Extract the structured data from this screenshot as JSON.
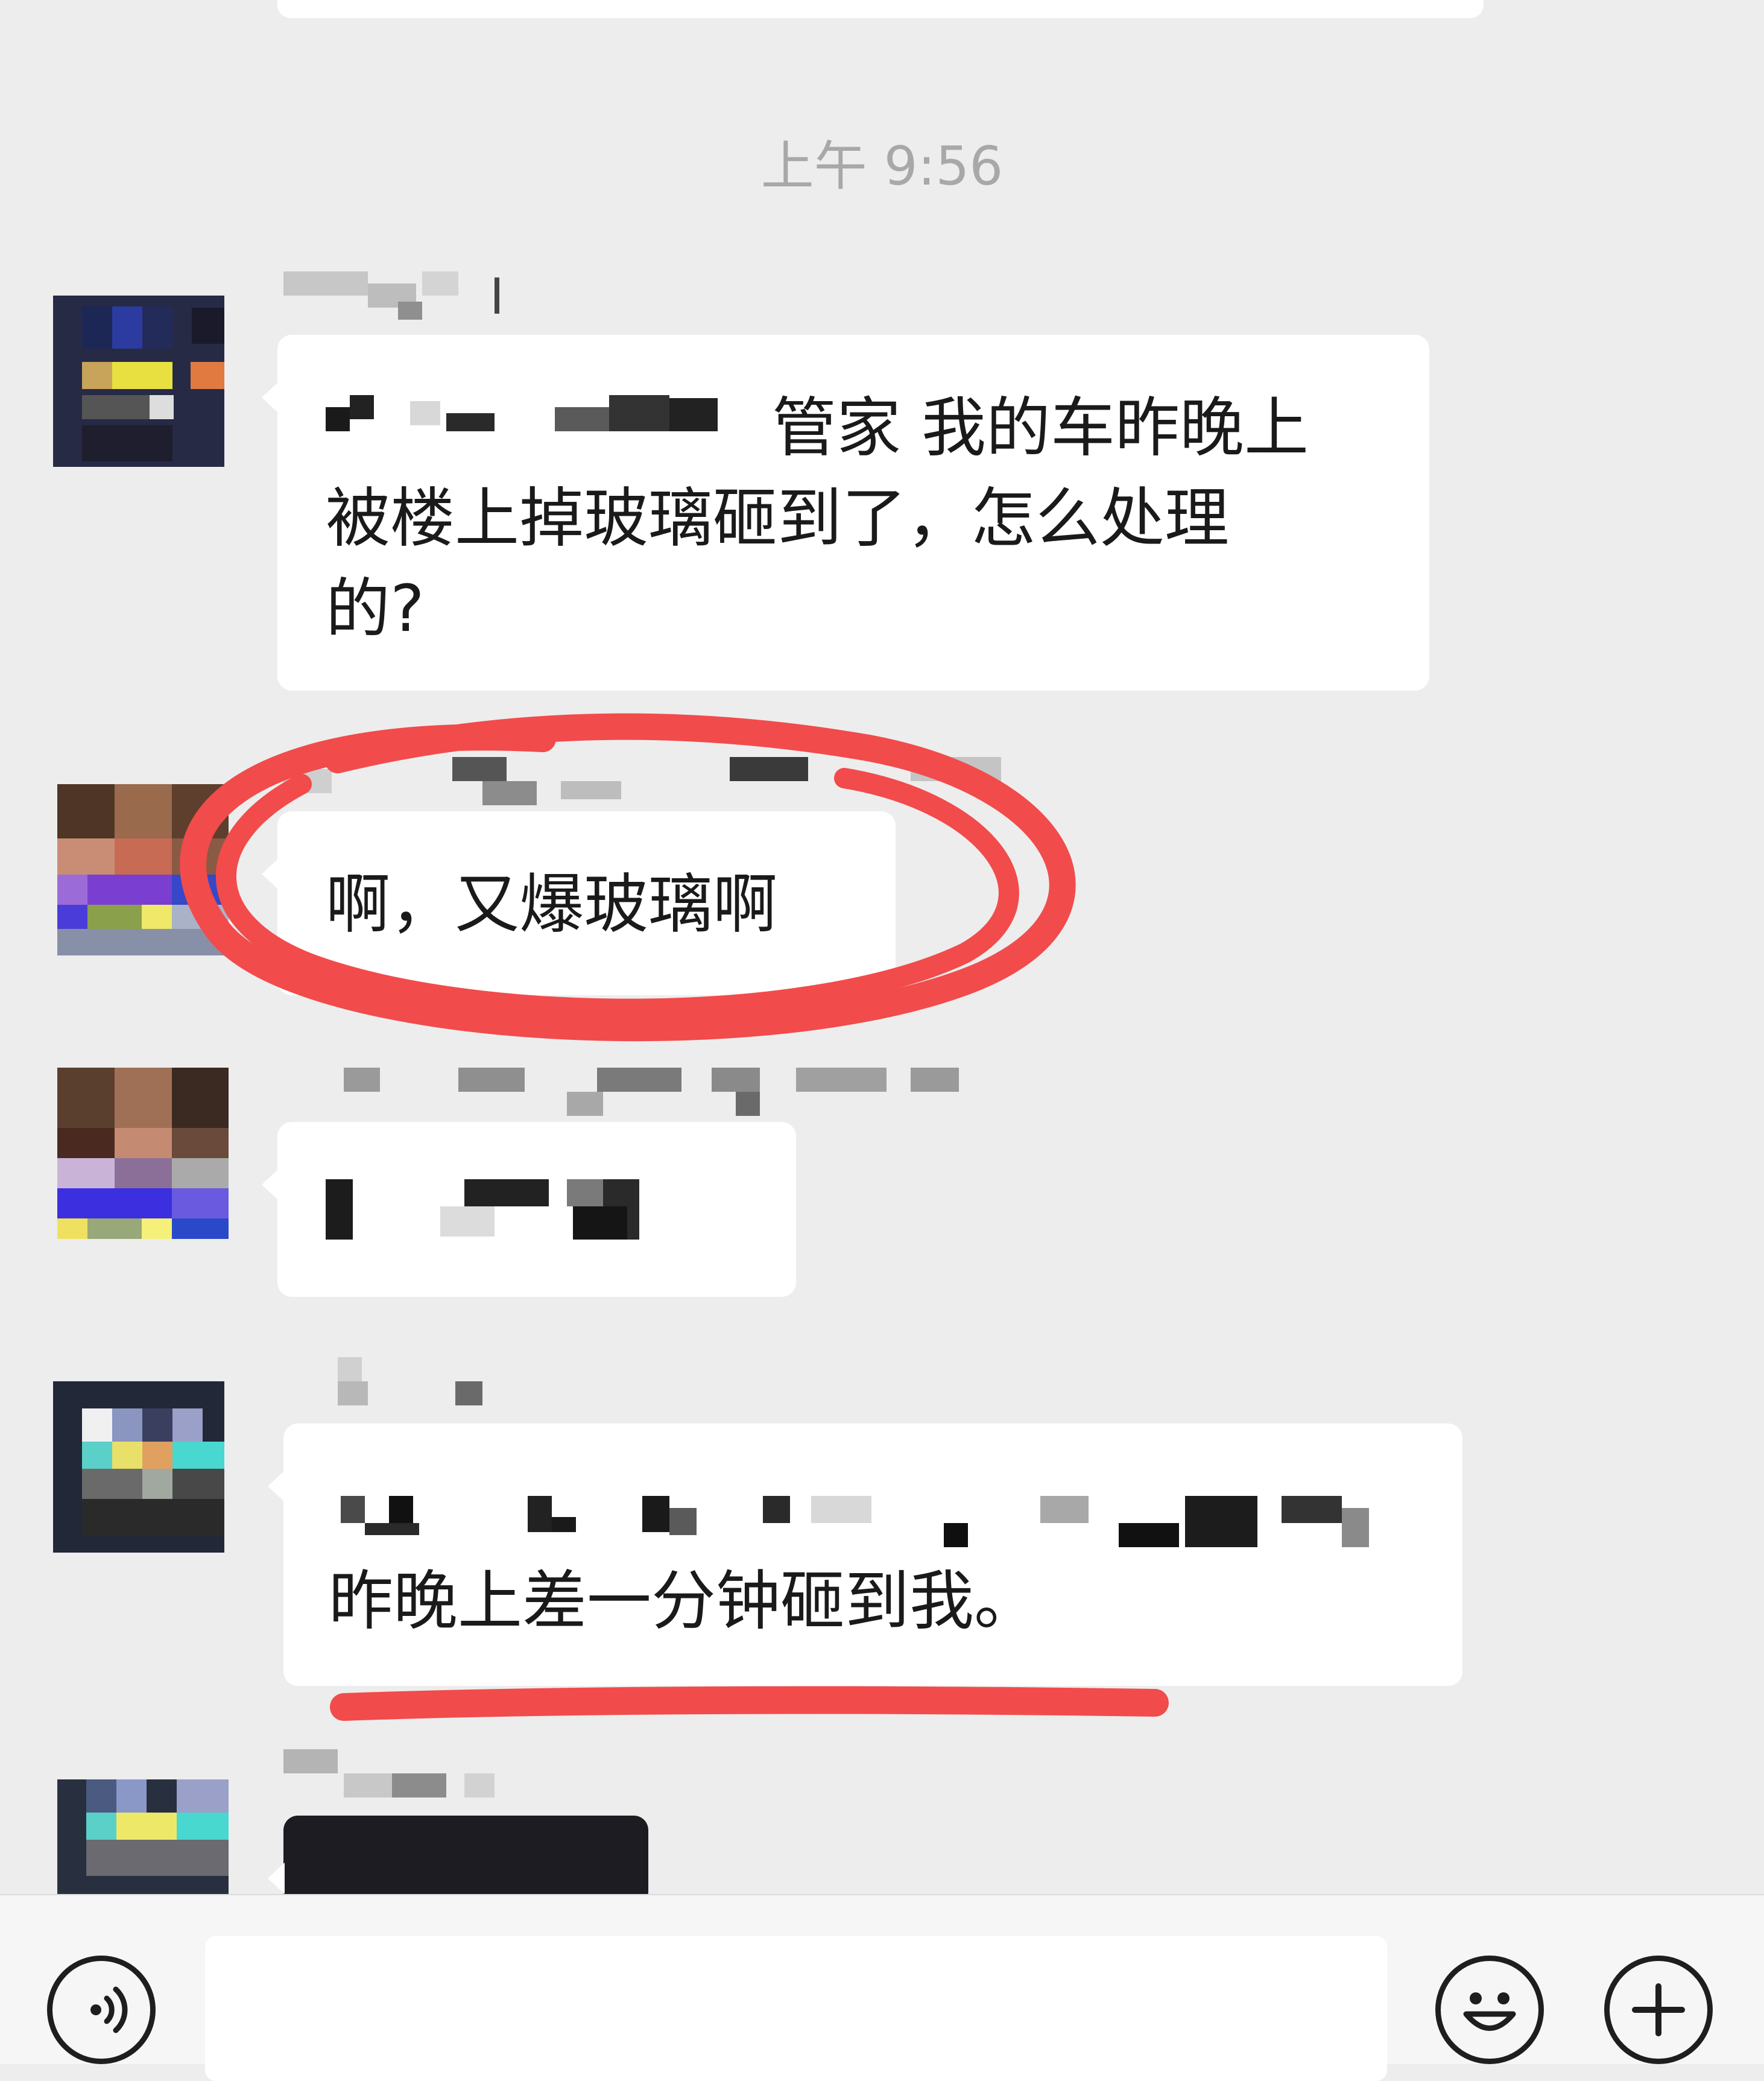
{
  "chat": {
    "timestamp": "上午 9:56",
    "messages": [
      {
        "sender": "",
        "text_line1_visible": "管家 我的车昨晚上",
        "text_line2": "被楼上掉玻璃砸到了，怎么处理",
        "text_line3": "的?"
      },
      {
        "sender": "",
        "text": "啊，又爆玻璃啊"
      },
      {
        "sender": "",
        "text": ""
      },
      {
        "sender": "",
        "text_line2": "昨晚上差一分钟砸到我。"
      },
      {
        "sender": "",
        "text": ""
      }
    ]
  },
  "input_bar": {
    "voice_icon": "voice-icon",
    "emoji_icon": "emoji-icon",
    "plus_icon": "plus-icon",
    "placeholder": ""
  },
  "annotations": {
    "color": "#f24b4b"
  },
  "colors": {
    "background": "#ededed",
    "bubble": "#ffffff",
    "timestamp": "#a8a8a8"
  }
}
